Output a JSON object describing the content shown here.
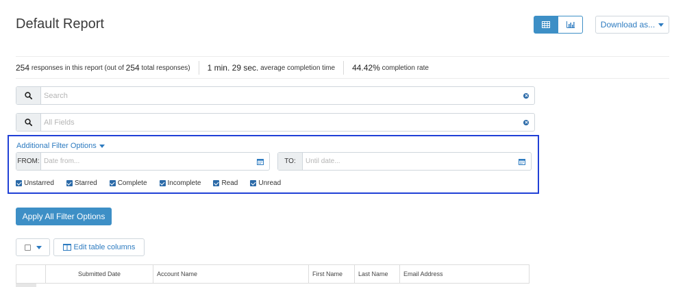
{
  "header": {
    "title": "Default Report",
    "download_label": "Download as...",
    "view_icons": [
      "table-icon",
      "bar-chart-icon"
    ],
    "accent_color": "#3d8fc6"
  },
  "stats": {
    "responses_count": "254",
    "responses_text": "responses in this report (out of",
    "total_count": "254",
    "total_text": "total responses)",
    "avg_time_value": "1 min. 29 sec.",
    "avg_time_label": "average completion time",
    "completion_value": "44.42%",
    "completion_label": "completion rate"
  },
  "search": {
    "placeholder": "Search",
    "fields_placeholder": "All Fields"
  },
  "filters": {
    "toggle_label": "Additional Filter Options",
    "from_label": "FROM:",
    "from_placeholder": "Date from...",
    "to_label": "TO:",
    "to_placeholder": "Until date...",
    "checkboxes": [
      {
        "label": "Unstarred",
        "checked": true
      },
      {
        "label": "Starred",
        "checked": true
      },
      {
        "label": "Complete",
        "checked": true
      },
      {
        "label": "Incomplete",
        "checked": true
      },
      {
        "label": "Read",
        "checked": true
      },
      {
        "label": "Unread",
        "checked": true
      }
    ],
    "highlight_color": "#1f3fd6"
  },
  "actions": {
    "apply_label": "Apply All Filter Options",
    "edit_columns_label": "Edit table columns"
  },
  "table": {
    "columns": [
      "Submitted Date",
      "Account Name",
      "First Name",
      "Last Name",
      "Email Address"
    ]
  }
}
